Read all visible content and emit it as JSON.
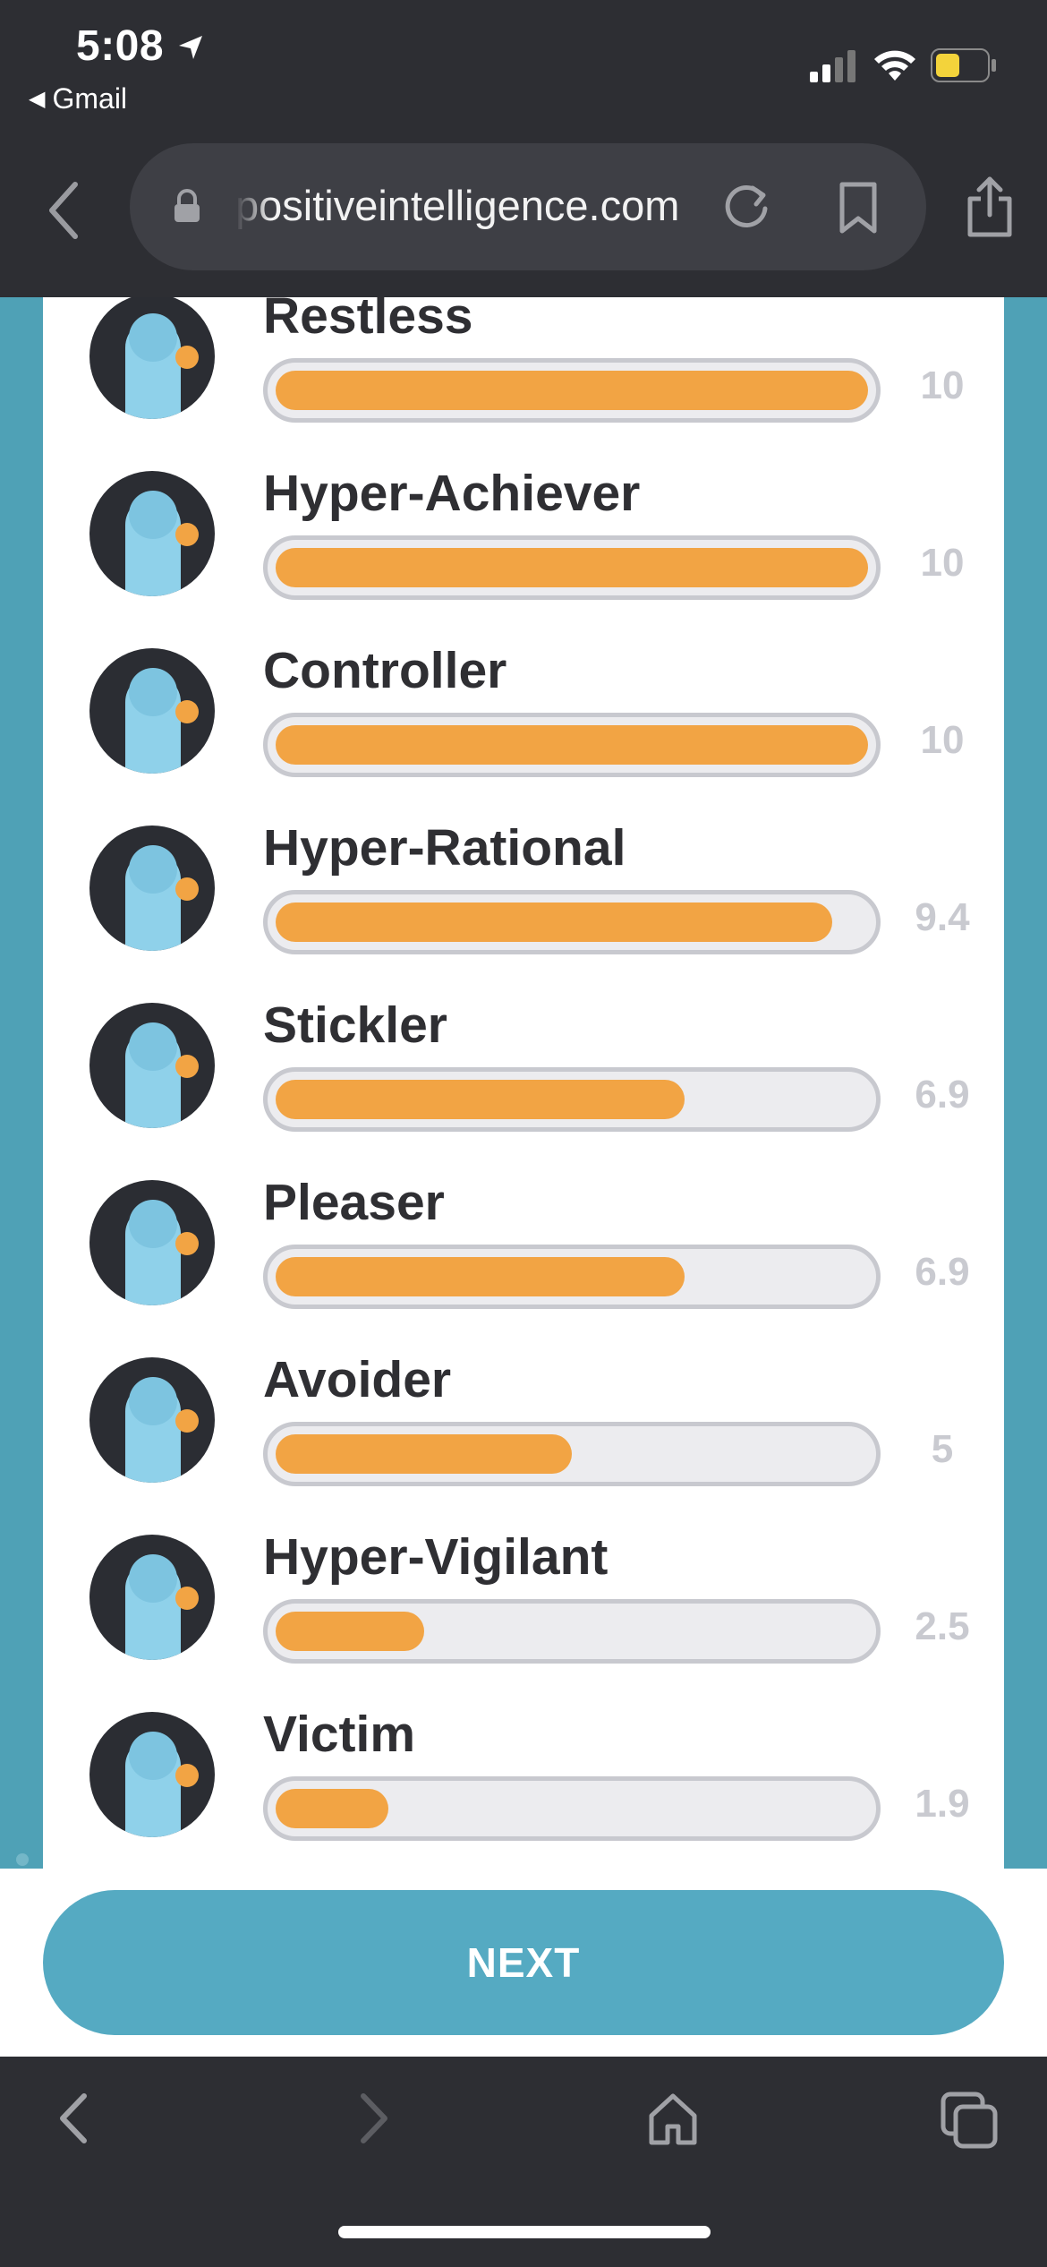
{
  "status_bar": {
    "time": "5:08",
    "back_app": "Gmail"
  },
  "browser": {
    "url": "positiveintelligence.com"
  },
  "saboteurs": [
    {
      "name": "Restless",
      "score": 10,
      "score_label": "10"
    },
    {
      "name": "Hyper-Achiever",
      "score": 10,
      "score_label": "10"
    },
    {
      "name": "Controller",
      "score": 10,
      "score_label": "10"
    },
    {
      "name": "Hyper-Rational",
      "score": 9.4,
      "score_label": "9.4"
    },
    {
      "name": "Stickler",
      "score": 6.9,
      "score_label": "6.9"
    },
    {
      "name": "Pleaser",
      "score": 6.9,
      "score_label": "6.9"
    },
    {
      "name": "Avoider",
      "score": 5,
      "score_label": "5"
    },
    {
      "name": "Hyper-Vigilant",
      "score": 2.5,
      "score_label": "2.5"
    },
    {
      "name": "Victim",
      "score": 1.9,
      "score_label": "1.9"
    }
  ],
  "score_max": 10,
  "next_button": "NEXT",
  "colors": {
    "bar_fill": "#f2a444",
    "bar_track": "#ececef",
    "accent_teal": "#55aac2",
    "chrome_dark": "#2d2e33"
  }
}
